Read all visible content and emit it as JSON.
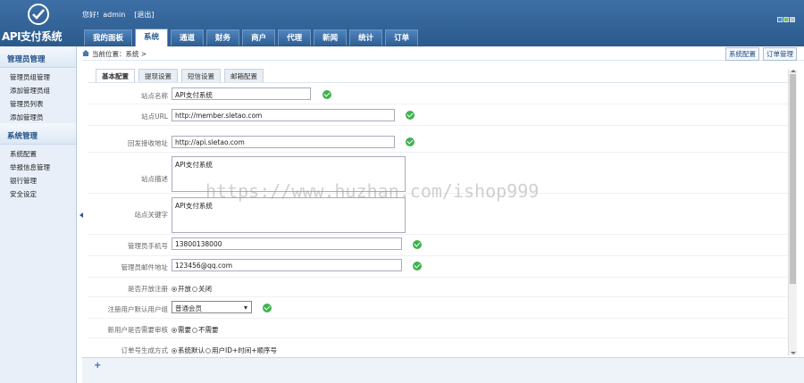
{
  "app": {
    "logo_text": "API支付系统",
    "greeting_prefix": "您好!",
    "username": "admin",
    "logout": "[退出]"
  },
  "nav": {
    "tabs": [
      {
        "label": "我的面板",
        "active": false
      },
      {
        "label": "系统",
        "active": true
      },
      {
        "label": "通道",
        "active": false
      },
      {
        "label": "财务",
        "active": false
      },
      {
        "label": "商户",
        "active": false
      },
      {
        "label": "代理",
        "active": false
      },
      {
        "label": "新闻",
        "active": false
      },
      {
        "label": "统计",
        "active": false
      },
      {
        "label": "订单",
        "active": false
      }
    ]
  },
  "sidebar": {
    "groups": [
      {
        "title": "管理员管理",
        "items": [
          "管理员组管理",
          "添加管理员组",
          "管理员列表",
          "添加管理员"
        ]
      },
      {
        "title": "系统管理",
        "items": [
          "系统配置",
          "举报信息管理",
          "银行管理",
          "安全设定"
        ]
      }
    ]
  },
  "breadcrumb": {
    "text": "当前位置：系统 >",
    "buttons": [
      "系统配置",
      "订单管理"
    ]
  },
  "sub_tabs": [
    {
      "label": "基本配置",
      "active": true
    },
    {
      "label": "提现设置",
      "active": false
    },
    {
      "label": "短信设置",
      "active": false
    },
    {
      "label": "邮箱配置",
      "active": false
    }
  ],
  "form": {
    "site_name": {
      "label": "站点名称",
      "value": "API支付系统"
    },
    "site_url": {
      "label": "站点URL",
      "value": "http://member.sletao.com"
    },
    "callback_url": {
      "label": "回发接收地址",
      "value": "http://api.sletao.com"
    },
    "site_desc": {
      "label": "站点描述",
      "value": "API支付系统"
    },
    "site_keywords": {
      "label": "站点关键字",
      "value": "API支付系统"
    },
    "admin_phone": {
      "label": "管理员手机号",
      "value": "13800138000"
    },
    "admin_email": {
      "label": "管理员邮件地址",
      "value": "123456@qq.com"
    },
    "open_register": {
      "label": "是否开放注册",
      "options": [
        "开放",
        "关闭"
      ],
      "selected": "开放"
    },
    "default_group": {
      "label": "注册用户默认用户组",
      "value": "普通会员"
    },
    "need_review": {
      "label": "新用户是否需要审核",
      "options": [
        "需要",
        "不需要"
      ],
      "selected": "需要"
    },
    "order_format": {
      "label": "订单号生成方式",
      "options": [
        "系统默认",
        "用户ID+时间+顺序号"
      ],
      "selected": "系统默认"
    }
  },
  "watermark": "https://www.huzhan.com/ishop999",
  "colors": {
    "header": "#2b5a8c",
    "ok": "#3fb34f",
    "sidebar": "#e8eff8"
  }
}
